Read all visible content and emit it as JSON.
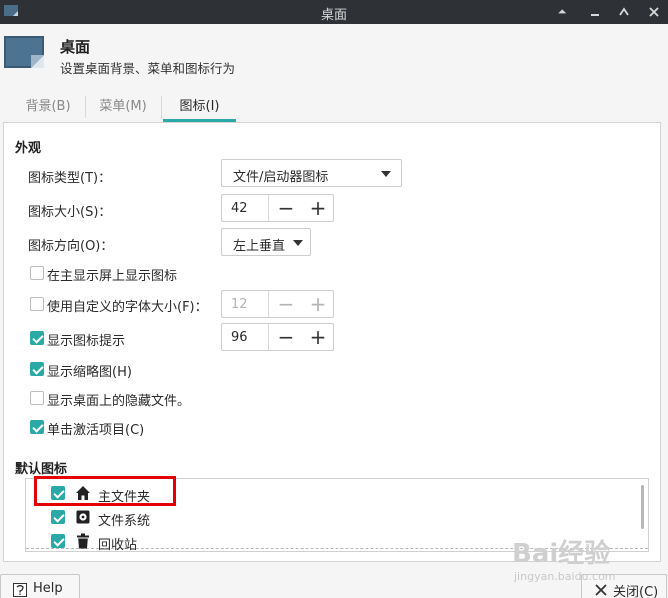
{
  "titlebar": {
    "title": "桌面"
  },
  "header": {
    "title": "桌面",
    "subtitle": "设置桌面背景、菜单和图标行为"
  },
  "tabs": [
    {
      "label": "背景(B)",
      "active": false
    },
    {
      "label": "菜单(M)",
      "active": false
    },
    {
      "label": "图标(I)",
      "active": true
    }
  ],
  "appearance": {
    "section_title": "外观",
    "icon_type": {
      "label": "图标类型(T)：",
      "value": "文件/启动器图标"
    },
    "icon_size": {
      "label": "图标大小(S)：",
      "value": "42"
    },
    "icon_orientation": {
      "label": "图标方向(O)：",
      "value": "左上垂直"
    },
    "show_on_primary": {
      "label": "在主显示屏上显示图标",
      "checked": false
    },
    "custom_font_size": {
      "label": "使用自定义的字体大小(F)：",
      "checked": false,
      "value": "12"
    },
    "show_tooltips": {
      "label": "显示图标提示",
      "checked": true,
      "value": "96"
    },
    "show_thumbnails": {
      "label": "显示缩略图(H)",
      "checked": true
    },
    "show_hidden": {
      "label": "显示桌面上的隐藏文件。",
      "checked": false
    },
    "single_click": {
      "label": "单击激活项目(C)",
      "checked": true
    }
  },
  "default_icons": {
    "section_title": "默认图标",
    "items": [
      {
        "label": "主文件夹",
        "checked": true,
        "icon": "home-icon"
      },
      {
        "label": "文件系统",
        "checked": true,
        "icon": "harddisk-icon"
      },
      {
        "label": "回收站",
        "checked": true,
        "icon": "trash-icon"
      }
    ]
  },
  "footer": {
    "help_label": "Help",
    "close_label": "关闭(C)"
  },
  "watermark": {
    "text": "Bai经验",
    "url": "jingyan.baidu.com"
  },
  "colors": {
    "accent": "#2aa9a6",
    "titlebar": "#2e3136",
    "highlight": "#e40000"
  }
}
